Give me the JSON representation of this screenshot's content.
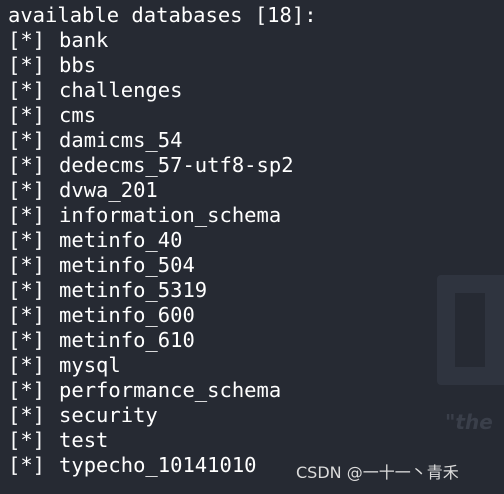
{
  "terminal": {
    "prompt_fragment": "                                          _",
    "header": "available databases [18]:",
    "marker": "[*]",
    "databases": [
      "bank",
      "bbs",
      "challenges",
      "cms",
      "damicms_54",
      "dedecms_57-utf8-sp2",
      "dvwa_201",
      "information_schema",
      "metinfo_40",
      "metinfo_504",
      "metinfo_5319",
      "metinfo_600",
      "metinfo_610",
      "mysql",
      "performance_schema",
      "security",
      "test",
      "typecho_10141010"
    ]
  },
  "background": {
    "tagline": "\"the"
  },
  "watermark": {
    "text": "CSDN @一十一丶青禾"
  },
  "colors": {
    "background": "#262a33",
    "text": "#ffffff"
  }
}
